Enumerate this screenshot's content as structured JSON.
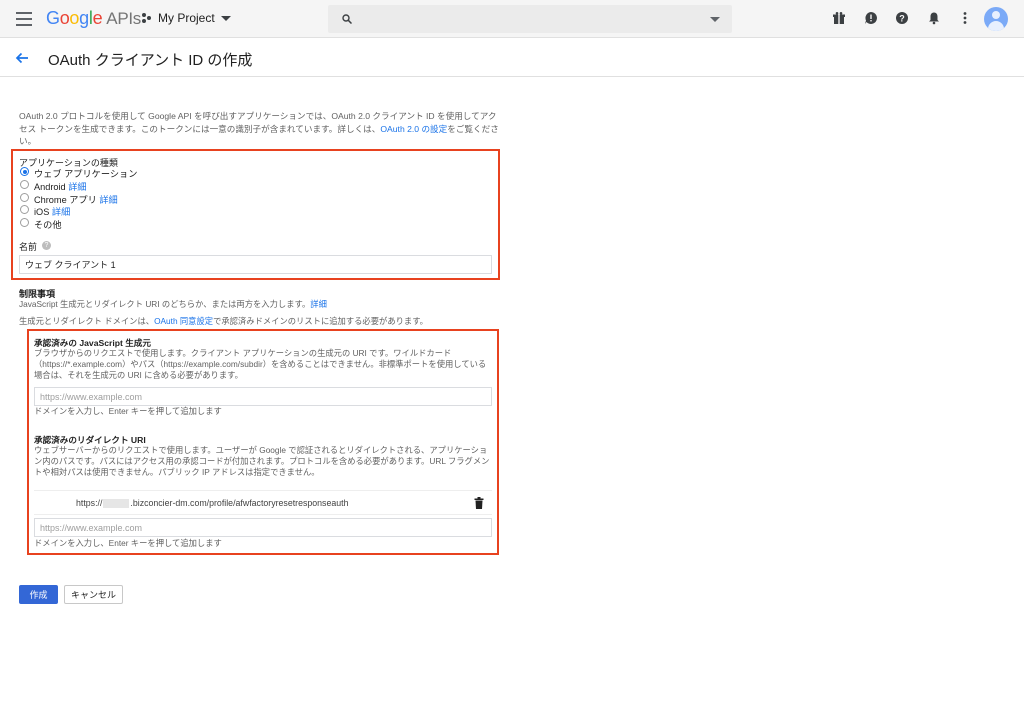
{
  "topbar": {
    "logo_google": "Google",
    "logo_apis": "APIs",
    "project_name": "My Project",
    "search_placeholder": ""
  },
  "header": {
    "title": "OAuth クライアント ID の作成"
  },
  "intro": {
    "text": "OAuth 2.0 プロトコルを使用して Google API を呼び出すアプリケーションでは、OAuth 2.0 クライアント ID を使用してアクセス トークンを生成できます。このトークンには一意の識別子が含まれています。詳しくは、",
    "link": "OAuth 2.0 の設定",
    "suffix": "をご覧ください。"
  },
  "app_type": {
    "label": "アプリケーションの種類",
    "options": [
      {
        "label": "ウェブ アプリケーション",
        "detail": ""
      },
      {
        "label": "Android",
        "detail": "詳細"
      },
      {
        "label": "Chrome アプリ",
        "detail": "詳細"
      },
      {
        "label": "iOS",
        "detail": "詳細"
      },
      {
        "label": "その他",
        "detail": ""
      }
    ],
    "selected": "ウェブ アプリケーション"
  },
  "name_field": {
    "label": "名前",
    "value": "ウェブ クライアント 1"
  },
  "restrictions": {
    "title": "制限事項",
    "line1": "JavaScript 生成元とリダイレクト URI のどちらか、または両方を入力します。",
    "line1_link": "詳細",
    "line2_prefix": "生成元とリダイレクト ドメインは、",
    "line2_link": "OAuth 同意設定",
    "line2_suffix": "で承認済みドメインのリストに追加する必要があります。"
  },
  "js_origins": {
    "title": "承認済みの JavaScript 生成元",
    "desc": "ブラウザからのリクエストで使用します。クライアント アプリケーションの生成元の URI です。ワイルドカード（https://*.example.com）やパス（https://example.com/subdir）を含めることはできません。非標準ポートを使用している場合は、それを生成元の URI に含める必要があります。",
    "placeholder": "https://www.example.com",
    "hint": "ドメインを入力し、Enter キーを押して追加します"
  },
  "redirect_uris": {
    "title": "承認済みのリダイレクト URI",
    "desc": "ウェブサーバーからのリクエストで使用します。ユーザーが Google で認証されるとリダイレクトされる、アプリケーション内のパスです。パスにはアクセス用の承認コードが付加されます。プロトコルを含める必要があります。URL フラグメントや相対パスは使用できません。パブリック IP アドレスは指定できません。",
    "entry_prefix": "https://",
    "entry_suffix": ".bizconcier-dm.com/profile/afwfactoryresetresponseauth",
    "placeholder": "https://www.example.com",
    "hint": "ドメインを入力し、Enter キーを押して追加します"
  },
  "actions": {
    "create": "作成",
    "cancel": "キャンセル"
  },
  "colors": {
    "accent": "#1a73e8",
    "primary_button": "#3367d6",
    "highlight_box": "#e8421f"
  }
}
